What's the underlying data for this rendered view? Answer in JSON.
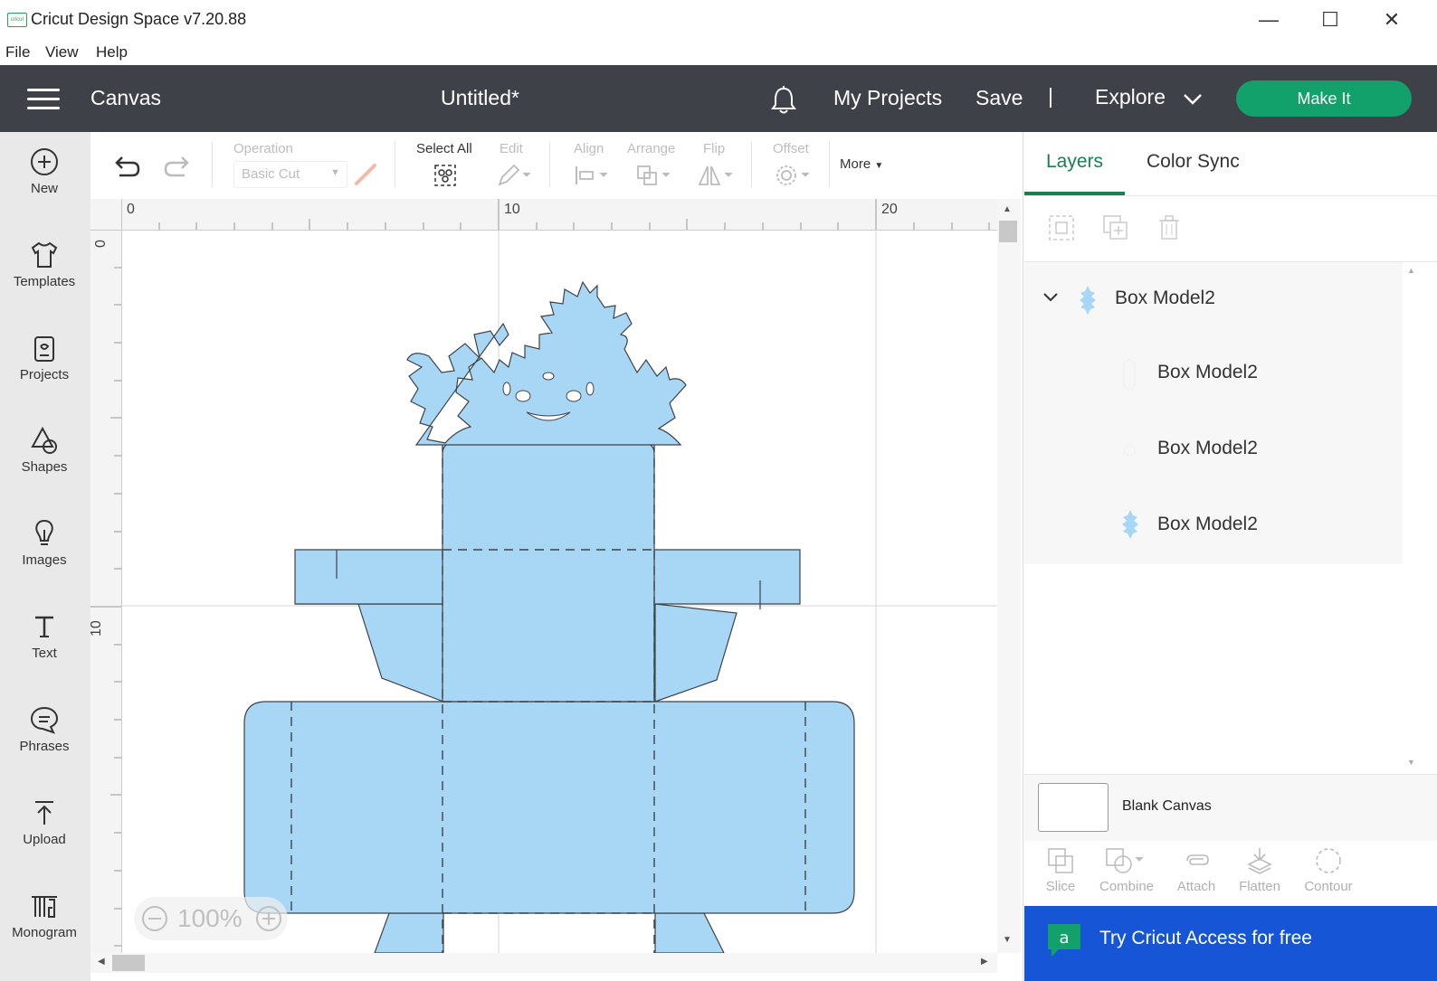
{
  "window": {
    "app_logo_text": "cricut",
    "title": "Cricut Design Space  v7.20.88",
    "minimize": "—",
    "maximize": "☐",
    "close": "✕"
  },
  "menu": {
    "file": "File",
    "view": "View",
    "help": "Help"
  },
  "header": {
    "section": "Canvas",
    "doc_title": "Untitled*",
    "my_projects": "My Projects",
    "save": "Save",
    "divider": "|",
    "explore": "Explore",
    "make_it": "Make It",
    "colors": {
      "bg": "#3e4248",
      "make_it": "#12a16b"
    }
  },
  "sidebar": {
    "items": [
      {
        "label": "New",
        "icon": "plus-circle-icon"
      },
      {
        "label": "Templates",
        "icon": "tshirt-icon"
      },
      {
        "label": "Projects",
        "icon": "projects-icon"
      },
      {
        "label": "Shapes",
        "icon": "shapes-icon"
      },
      {
        "label": "Images",
        "icon": "lightbulb-icon"
      },
      {
        "label": "Text",
        "icon": "text-icon"
      },
      {
        "label": "Phrases",
        "icon": "speech-bubble-icon"
      },
      {
        "label": "Upload",
        "icon": "upload-icon"
      },
      {
        "label": "Monogram",
        "icon": "monogram-icon"
      }
    ]
  },
  "toolbar": {
    "operation_label": "Operation",
    "operation_value": "Basic Cut",
    "select_all": "Select All",
    "edit": "Edit",
    "align": "Align",
    "arrange": "Arrange",
    "flip": "Flip",
    "offset": "Offset",
    "more": "More"
  },
  "canvas": {
    "ruler_top": [
      "0",
      "10",
      "20"
    ],
    "ruler_left": [
      "0",
      "10"
    ],
    "zoom": "100%",
    "fill_color": "#a7d7f5"
  },
  "right_panel": {
    "tabs": [
      "Layers",
      "Color Sync"
    ],
    "active_tab": "Layers",
    "layers": {
      "group": "Box Model2",
      "children": [
        "Box Model2",
        "Box Model2",
        "Box Model2"
      ]
    },
    "blank_canvas": "Blank Canvas",
    "tools": [
      "Slice",
      "Combine",
      "Attach",
      "Flatten",
      "Contour"
    ],
    "access_banner": "Try Cricut Access for free",
    "accent": "#1a7f4f",
    "banner_color": "#1656d6"
  }
}
